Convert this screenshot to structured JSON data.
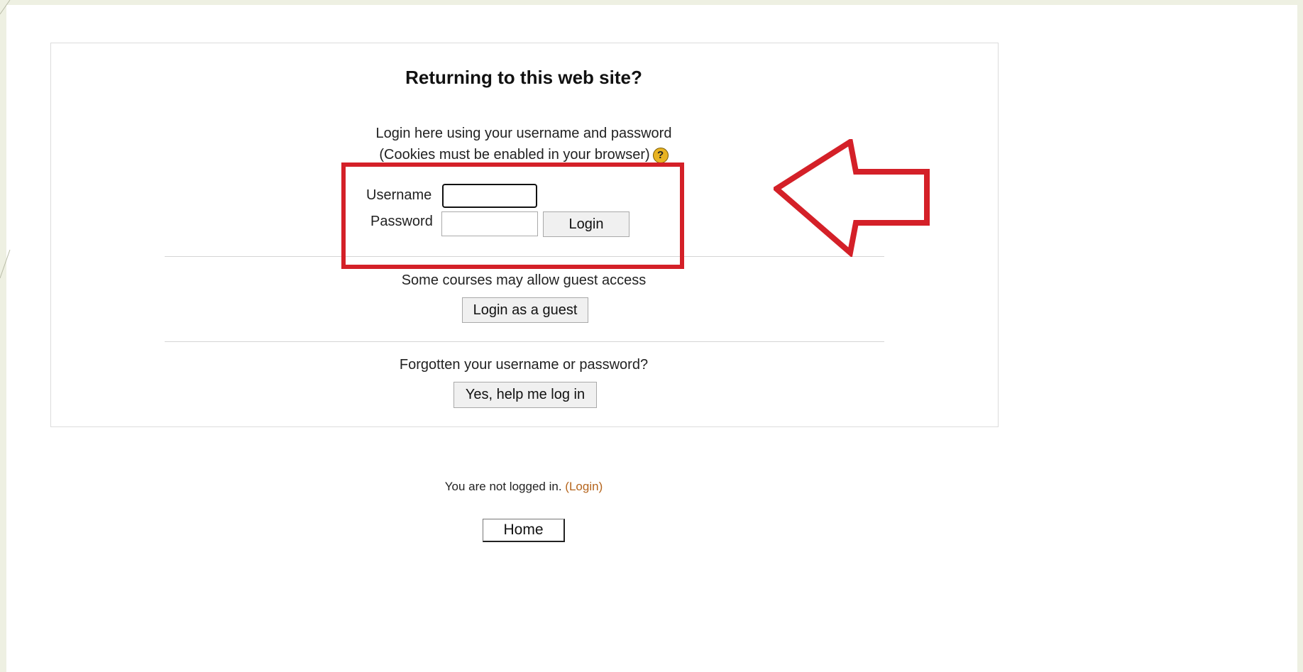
{
  "login_box": {
    "title": "Returning to this web site?",
    "intro_line1": "Login here using your username and password",
    "intro_line2": "(Cookies must be enabled in your browser)",
    "help_icon": "question-icon",
    "username_label": "Username",
    "username_value": "",
    "password_label": "Password",
    "password_value": "",
    "login_button": "Login",
    "guest_text": "Some courses may allow guest access",
    "guest_button": "Login as a guest",
    "forgot_text": "Forgotten your username or password?",
    "forgot_button": "Yes, help me log in"
  },
  "footer": {
    "status_text": "You are not logged in.",
    "paren_open": "(",
    "login_link": "Login",
    "paren_close": ")",
    "home_button": "Home"
  },
  "annotation": {
    "highlight_color": "#d42028",
    "arrow_icon": "left-arrow-outline-icon"
  },
  "colors": {
    "link": "#b5651d",
    "help_icon": "#e8b322",
    "slide_strip": "#eef0e2"
  }
}
